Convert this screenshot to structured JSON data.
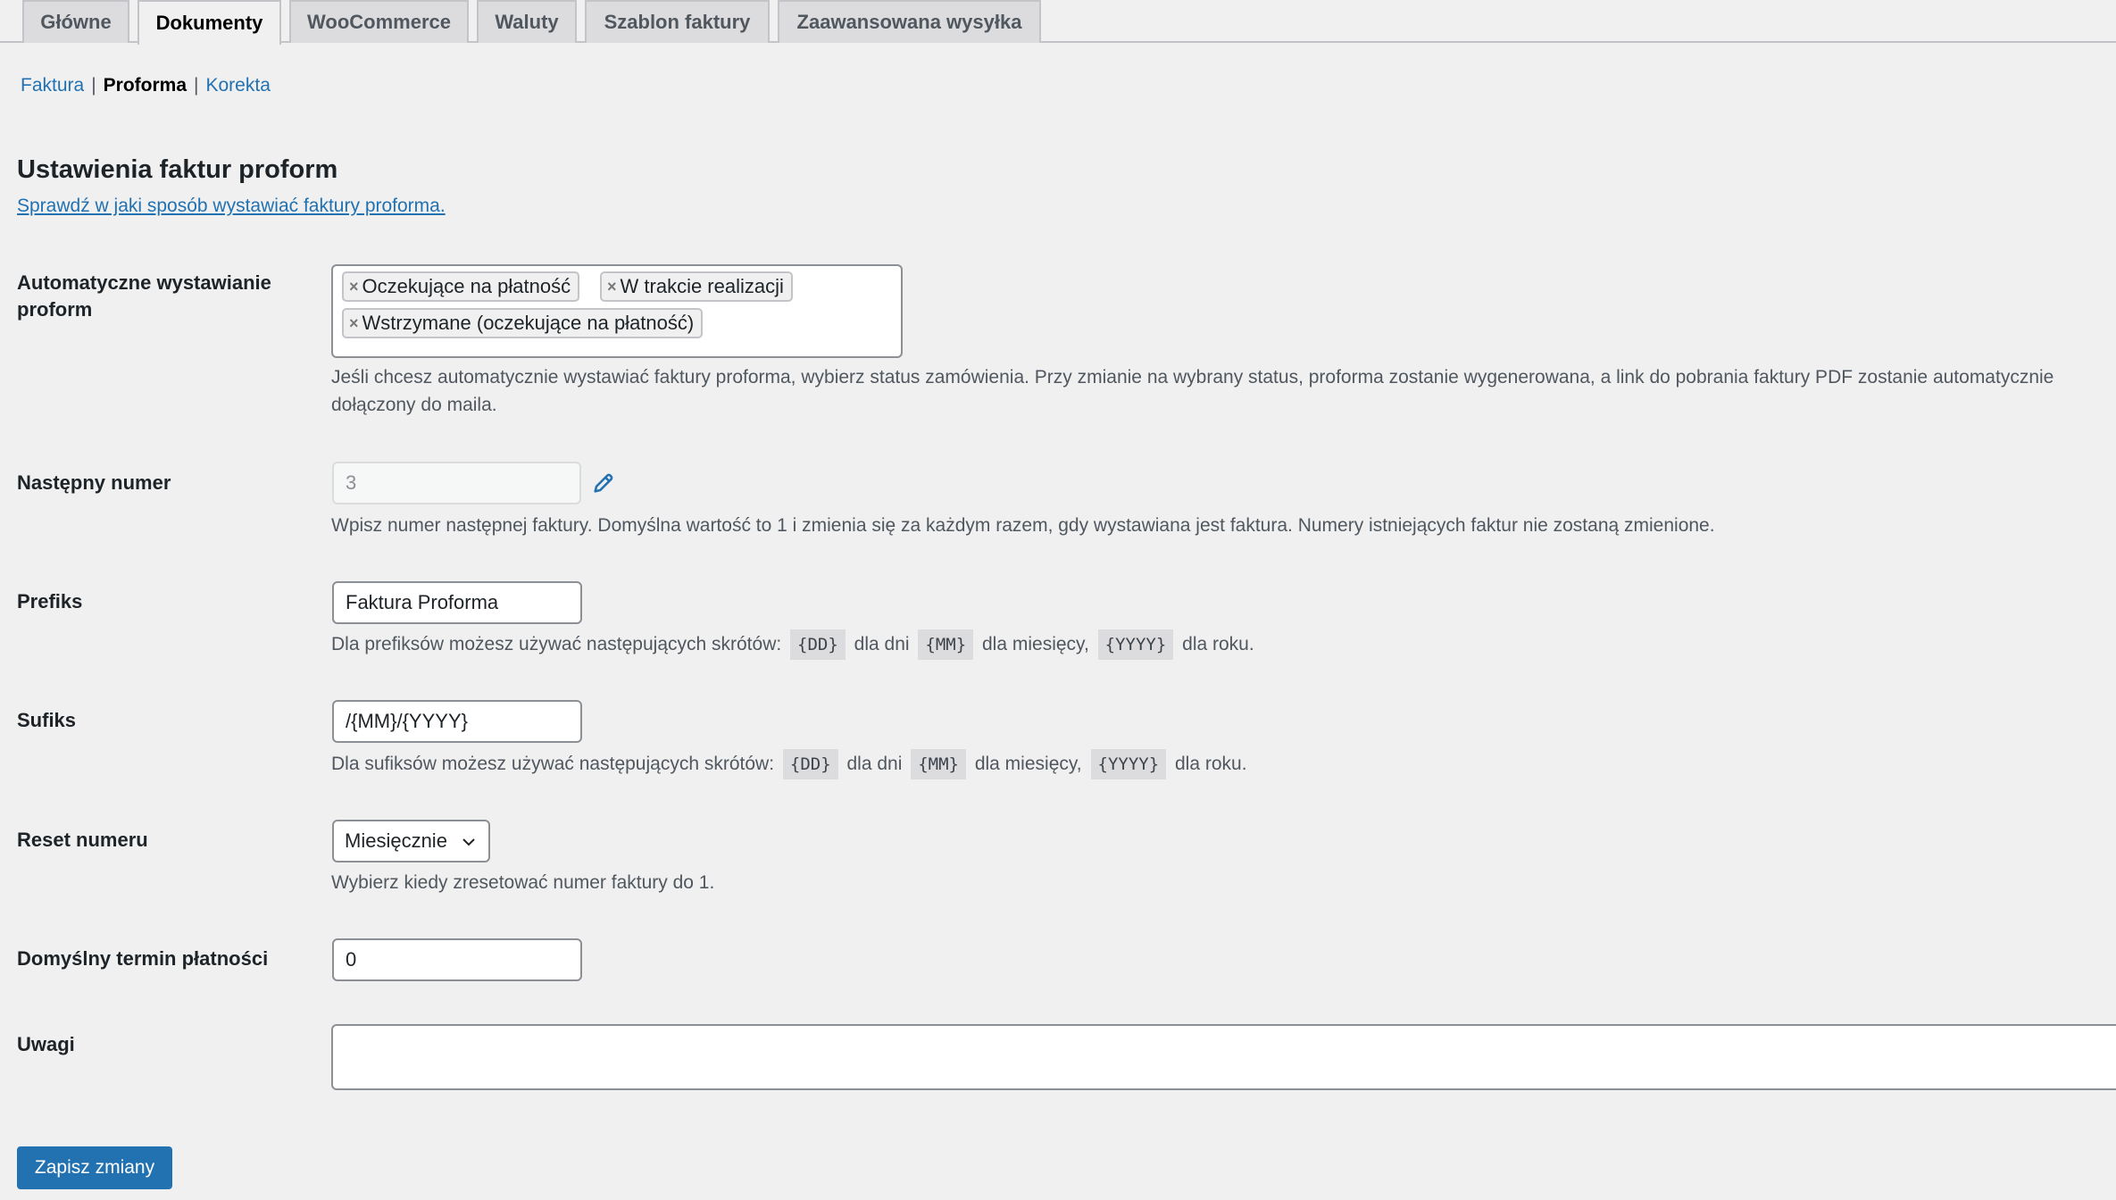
{
  "tabs": [
    {
      "label": "Główne"
    },
    {
      "label": "Dokumenty"
    },
    {
      "label": "WooCommerce"
    },
    {
      "label": "Waluty"
    },
    {
      "label": "Szablon faktury"
    },
    {
      "label": "Zaawansowana wysyłka"
    }
  ],
  "active_tab": "Dokumenty",
  "subnav": {
    "faktura": "Faktura",
    "proforma": "Proforma",
    "korekta": "Korekta",
    "separator": "|"
  },
  "heading": {
    "title": "Ustawienia faktur proform",
    "help_link": "Sprawdź w jaki sposób wystawiać faktury proforma."
  },
  "auto_issue": {
    "label": "Automatyczne wystawianie proform",
    "chips": [
      "Oczekujące na płatność",
      "W trakcie realizacji",
      "Wstrzymane (oczekujące na płatność)"
    ],
    "chip_remove": "×",
    "description": "Jeśli chcesz automatycznie wystawiać faktury proforma, wybierz status zamówienia. Przy zmianie na wybrany status, proforma zostanie wygenerowana, a link do pobrania faktury PDF zostanie automatycznie dołączony do maila."
  },
  "next_number": {
    "label": "Następny numer",
    "value": "3",
    "description": "Wpisz numer następnej faktury. Domyślna wartość to 1 i zmienia się za każdym razem, gdy wystawiana jest faktura. Numery istniejących faktur nie zostaną zmienione."
  },
  "prefix": {
    "label": "Prefiks",
    "value": "Faktura Proforma",
    "desc_start": "Dla prefiksów możesz używać następujących skrótów:",
    "code_dd": "{DD}",
    "txt_days": "dla dni",
    "code_mm": "{MM}",
    "txt_months": "dla miesięcy,",
    "code_yyyy": "{YYYY}",
    "txt_year": "dla roku."
  },
  "suffix": {
    "label": "Sufiks",
    "value": "/{MM}/{YYYY}",
    "desc_start": "Dla sufiksów możesz używać następujących skrótów:",
    "code_dd": "{DD}",
    "txt_days": "dla dni",
    "code_mm": "{MM}",
    "txt_months": "dla miesięcy,",
    "code_yyyy": "{YYYY}",
    "txt_year": "dla roku."
  },
  "reset": {
    "label": "Reset numeru",
    "selected": "Miesięcznie",
    "description": "Wybierz kiedy zresetować numer faktury do 1."
  },
  "payment_term": {
    "label": "Domyślny termin płatności",
    "value": "0"
  },
  "notes": {
    "label": "Uwagi",
    "value": ""
  },
  "save_button": "Zapisz zmiany",
  "icons": {
    "edit": "pencil-icon",
    "dropdown": "chevron-down-icon",
    "remove": "close-icon"
  },
  "colors": {
    "accent": "#2271b1",
    "background": "#f0f0f1"
  }
}
